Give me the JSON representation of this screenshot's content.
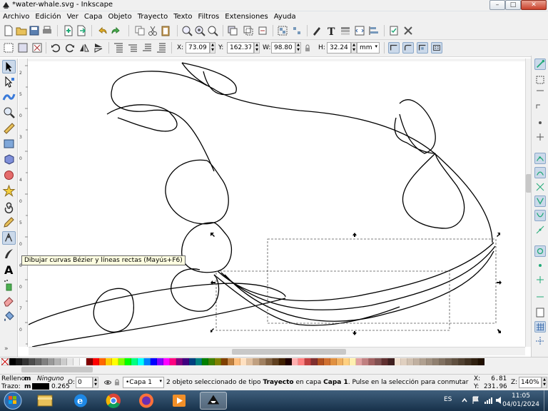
{
  "window": {
    "title": "*water-whale.svg - Inkscape",
    "controls": [
      "–",
      "□",
      "✕"
    ]
  },
  "menu": [
    "Archivo",
    "Edición",
    "Ver",
    "Capa",
    "Objeto",
    "Trayecto",
    "Texto",
    "Filtros",
    "Extensiones",
    "Ayuda"
  ],
  "selector_toolbar": {
    "x_label": "X:",
    "x_value": "73.090",
    "y_label": "Y:",
    "y_value": "162.371",
    "w_label": "W:",
    "w_value": "98.802",
    "h_label": "H:",
    "h_value": "32.248",
    "unit": "mm"
  },
  "tooltip": "Dibujar curvas Bézier y líneas rectas (Mayús+F6)",
  "ruler_ticks": [
    "2",
    "5",
    "0",
    "3",
    "0",
    "4",
    "0",
    "5",
    "0",
    "6",
    "0",
    "7",
    "0"
  ],
  "status": {
    "fill_label": "Relleno:",
    "fill_indicator": "m",
    "fill_value": "Ninguno",
    "stroke_label": "Trazo:",
    "stroke_indicator": "m",
    "stroke_width": "0.265",
    "opacity_label": "O:",
    "opacity_value": "0",
    "layer_value": "•Capa 1",
    "msg_1": "2 objeto seleccionado de tipo ",
    "msg_type": "Trayecto",
    "msg_2": " en capa ",
    "msg_layer": "Capa 1",
    "msg_3": ". Pulse en la selección para conmutar los tiradores d...",
    "x_label": "X:",
    "x_value": "6.81",
    "y_label": "Y:",
    "y_value": "231.96",
    "zoom_label": "Z:",
    "zoom_value": "140%"
  },
  "taskbar": {
    "language": "ES",
    "time": "11:05",
    "date": "04/01/2024"
  },
  "colors": {
    "chrome": "#f0f0f0",
    "active_tool": "#cbd9ea",
    "taskbar": "#234461",
    "tooltip": "#ffffe1"
  },
  "palette_colors": [
    "#000000",
    "#1a1a1a",
    "#333333",
    "#4d4d4d",
    "#666666",
    "#808080",
    "#999999",
    "#b3b3b3",
    "#cccccc",
    "#e6e6e6",
    "#f2f2f2",
    "#ffffff",
    "#800000",
    "#ff0000",
    "#ff6600",
    "#ffcc00",
    "#ffff00",
    "#80ff00",
    "#00ff00",
    "#00ff80",
    "#00ffff",
    "#0080ff",
    "#0000ff",
    "#8000ff",
    "#ff00ff",
    "#ff0080",
    "#800080",
    "#400080",
    "#004080",
    "#008080",
    "#008000",
    "#408000",
    "#808000",
    "#804000",
    "#c08040",
    "#ffc080",
    "#ffe0c0",
    "#e0c0a0",
    "#c0a080",
    "#a08060",
    "#806040",
    "#604020",
    "#402000",
    "#200000",
    "#ffb0b0",
    "#ff8080",
    "#c04040",
    "#803030",
    "#b05020",
    "#d07030",
    "#e09040",
    "#f0b060",
    "#ffd080",
    "#fff0b0",
    "#e0a0a0",
    "#c08080",
    "#a06060",
    "#805050",
    "#603030",
    "#402020",
    "#f0e0d0",
    "#e0d0c0",
    "#d0c0b0",
    "#c0b0a0",
    "#b0a090",
    "#a09080",
    "#908070",
    "#807060",
    "#706050",
    "#605040",
    "#504030",
    "#403020",
    "#302010",
    "#201000"
  ]
}
